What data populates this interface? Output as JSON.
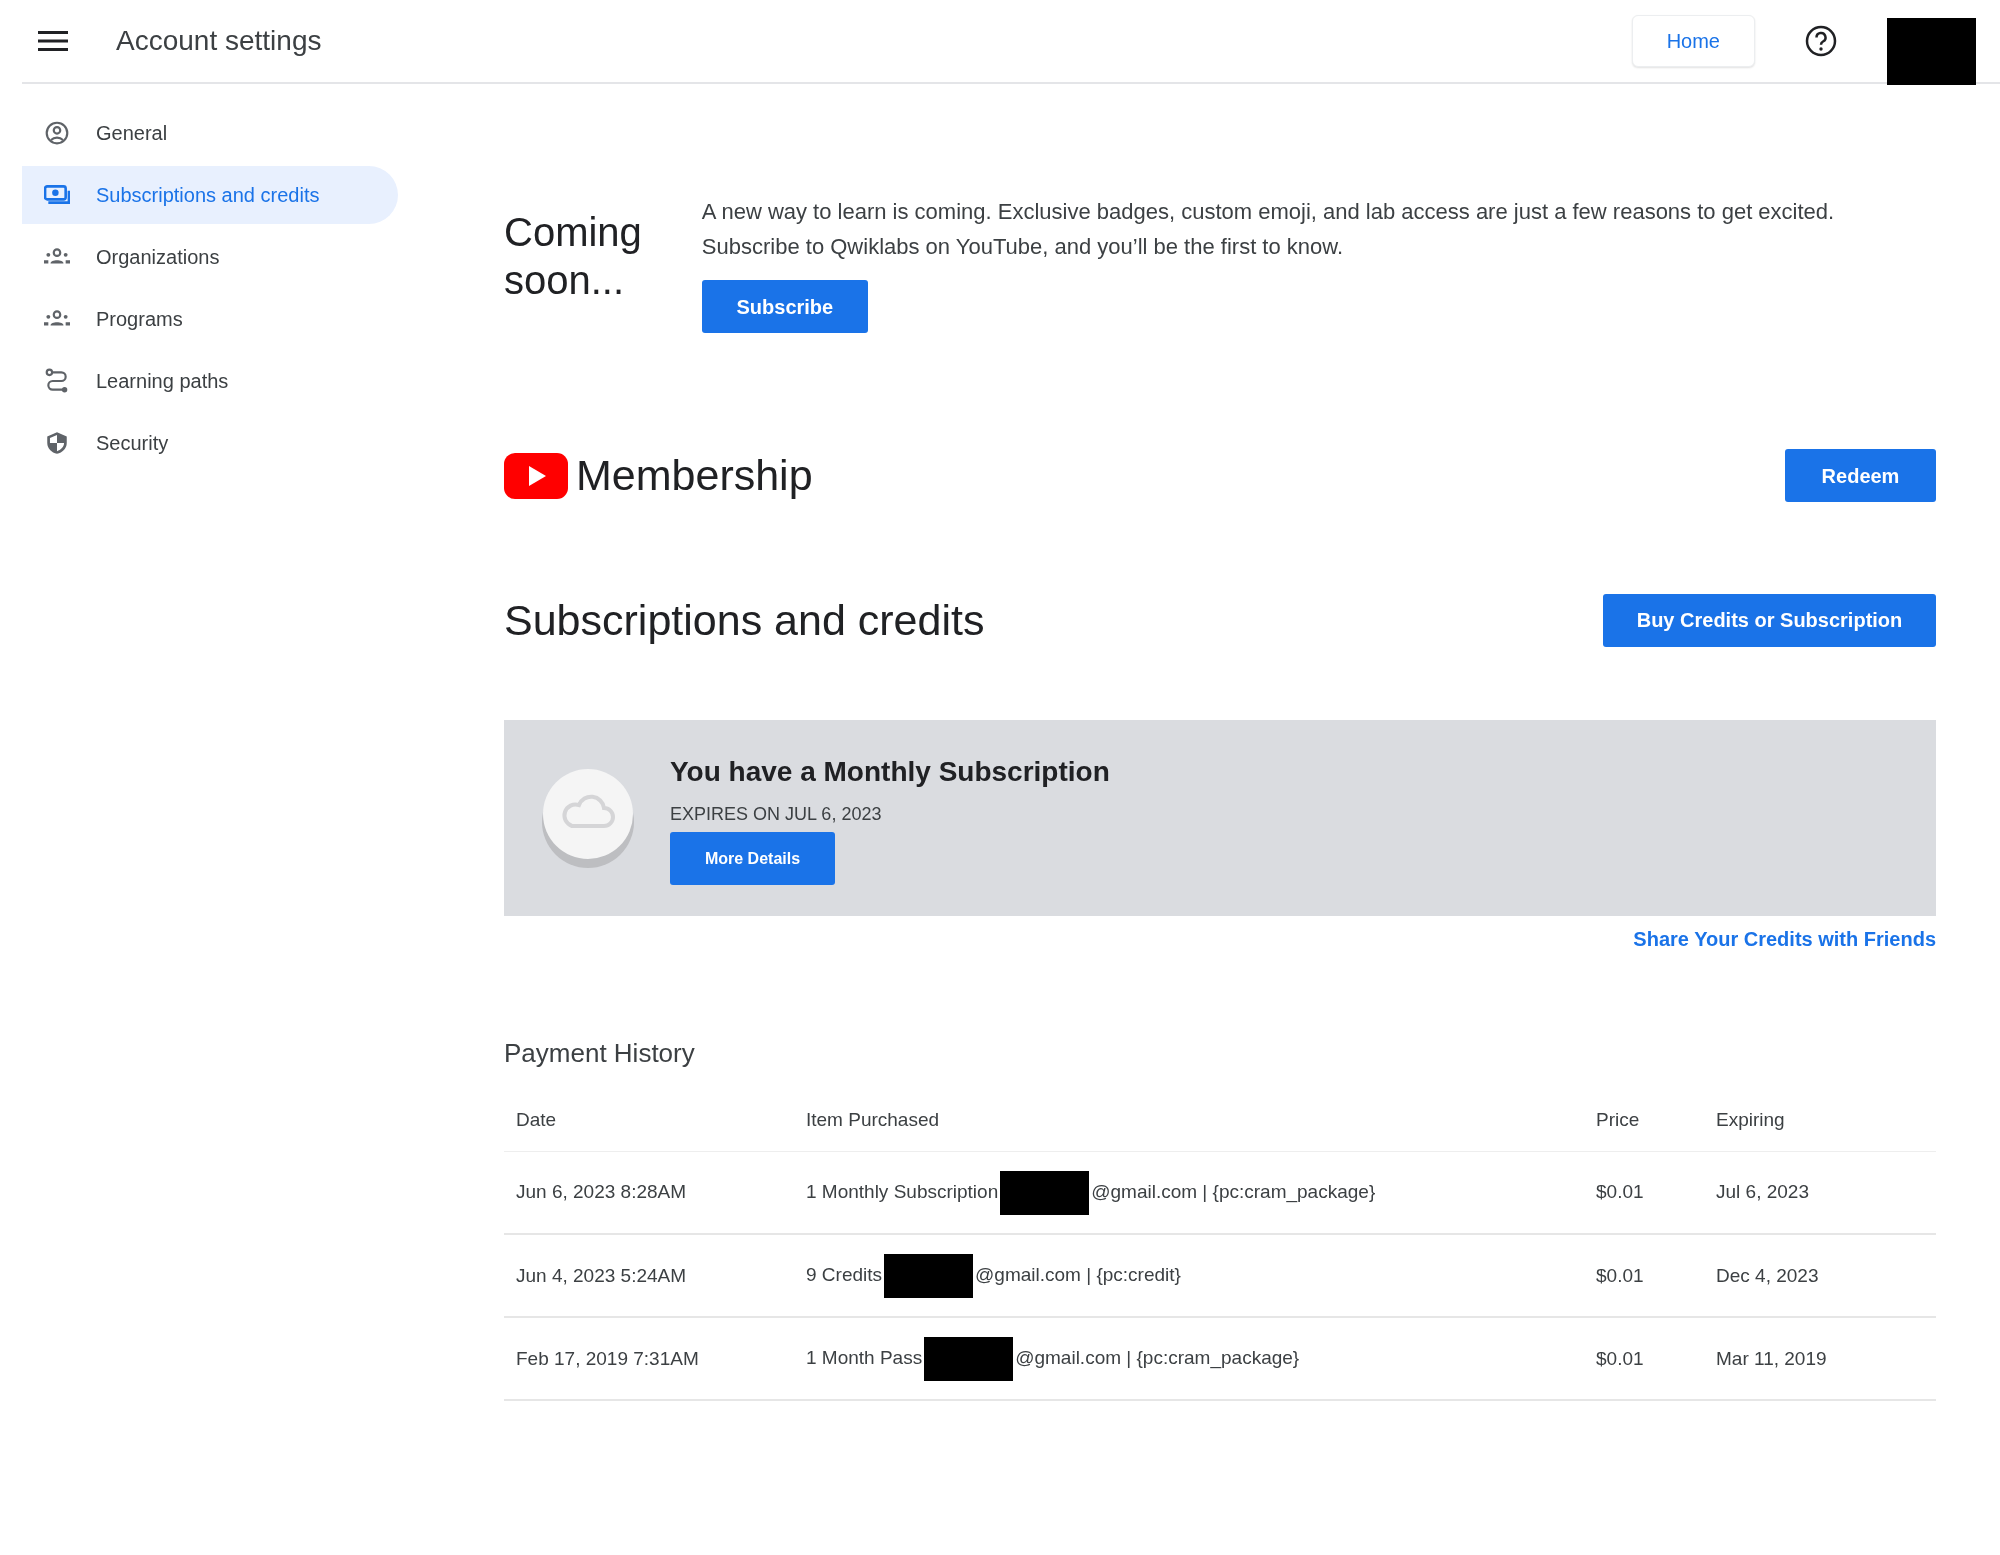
{
  "header": {
    "title": "Account settings",
    "home_button": "Home"
  },
  "sidebar": {
    "items": [
      {
        "label": "General",
        "selected": false
      },
      {
        "label": "Subscriptions and credits",
        "selected": true
      },
      {
        "label": "Organizations",
        "selected": false
      },
      {
        "label": "Programs",
        "selected": false
      },
      {
        "label": "Learning paths",
        "selected": false
      },
      {
        "label": "Security",
        "selected": false
      }
    ]
  },
  "coming_soon": {
    "title": "Coming soon...",
    "text": "A new way to learn is coming. Exclusive badges, custom emoji, and lab access are just a few reasons to get excited. Subscribe to Qwiklabs on YouTube, and you’ll be the first to know.",
    "button": "Subscribe"
  },
  "membership": {
    "title": "Membership",
    "button": "Redeem"
  },
  "subscriptions": {
    "title": "Subscriptions and credits",
    "button": "Buy Credits or Subscription",
    "card": {
      "title": "You have a Monthly Subscription",
      "subtitle": "EXPIRES ON JUL 6, 2023",
      "button": "More Details"
    },
    "share_link": "Share Your Credits with Friends"
  },
  "payment_history": {
    "title": "Payment History",
    "columns": [
      "Date",
      "Item Purchased",
      "Price",
      "Expiring"
    ],
    "rows": [
      {
        "date": "Jun 6, 2023 8:28AM",
        "item_before": "1 Monthly Subscription",
        "item_after": "@gmail.com | {pc:cram_package}",
        "price": "$0.01",
        "expiring": "Jul 6, 2023"
      },
      {
        "date": "Jun 4, 2023 5:24AM",
        "item_before": "9 Credits",
        "item_after": "@gmail.com | {pc:credit}",
        "price": "$0.01",
        "expiring": "Dec 4, 2023"
      },
      {
        "date": "Feb 17, 2019 7:31AM",
        "item_before": "1 Month Pass",
        "item_after": "@gmail.com | {pc:cram_package}",
        "price": "$0.01",
        "expiring": "Mar 11, 2019"
      }
    ]
  }
}
